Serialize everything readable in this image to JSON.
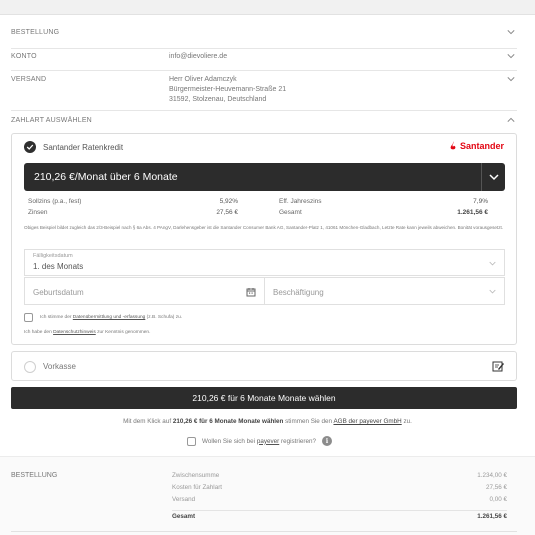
{
  "sections": {
    "bestellung_label": "BESTELLUNG",
    "konto_label": "KONTO",
    "konto_value": "info@dievoliere.de",
    "versand_label": "VERSAND",
    "versand_lines": [
      "Herr Oliver Adamczyk",
      "Bürgermeister-Heuvemann-Straße 21",
      "31592, Stolzenau, Deutschland"
    ],
    "zahlart_label": "ZAHLART AUSWÄHLEN"
  },
  "payment": {
    "method_name": "Santander Ratenkredit",
    "brand": "Santander",
    "brand_color": "#e30613",
    "selected_plan": "210,26 €/Monat über 6 Monate",
    "rates": {
      "sollzins_label": "Sollzins (p.a., fest)",
      "sollzins_value": "5,92%",
      "zinsen_label": "Zinsen",
      "zinsen_value": "27,56 €",
      "eff_label": "Eff. Jahreszins",
      "eff_value": "7,9%",
      "gesamt_label": "Gesamt",
      "gesamt_value": "1.261,56 €"
    },
    "legal_text": "Obiges Beispiel bildet zugleich das 2/3-Beispiel nach § 6a Abs. 4 PAngV, Darlehensgeber ist die Santander Consumer Bank AG, Santander-Platz 1, 41061 Mönchen-Gladbach, Letzte Rate kann jeweils abweichen. Bonität vorausgesetzt.",
    "faelligkeit_label": "Fälligkeitsdatum",
    "faelligkeit_value": "1. des Monats",
    "geburtsdatum_placeholder": "Geburtsdatum",
    "beschaeftigung_placeholder": "Beschäftigung",
    "consent_prefix": "Ich stimme der ",
    "consent_link": "Datenübermittlung und -erfassung",
    "consent_suffix": " (z.B. Schufa) zu.",
    "privacy_prefix": "Ich habe den ",
    "privacy_link": "Datenschutzhinweis",
    "privacy_suffix": " zur Kenntnis genommen."
  },
  "vorkasse": {
    "label": "Vorkasse",
    "icon": "invoice-edit-icon"
  },
  "cta": {
    "label": "210,26 € für 6 Monate Monate wählen"
  },
  "agb": {
    "prefix": "Mit dem Klick auf ",
    "bold": "210,26 € für 6 Monate Monate wählen",
    "middle": " stimmen Sie den ",
    "link": "AGB der payever GmbH",
    "suffix": " zu."
  },
  "register": {
    "prefix": "Wollen Sie sich bei ",
    "link": "payever",
    "suffix": " registrieren?",
    "info_glyph": "i"
  },
  "summary": {
    "title": "BESTELLUNG",
    "rows": [
      {
        "label": "Zwischensumme",
        "value": "1.234,00 €"
      },
      {
        "label": "Kosten für Zahlart",
        "value": "27,56 €"
      },
      {
        "label": "Versand",
        "value": "0,00 €"
      }
    ],
    "total_label": "Gesamt",
    "total_value": "1.261,56 €"
  }
}
